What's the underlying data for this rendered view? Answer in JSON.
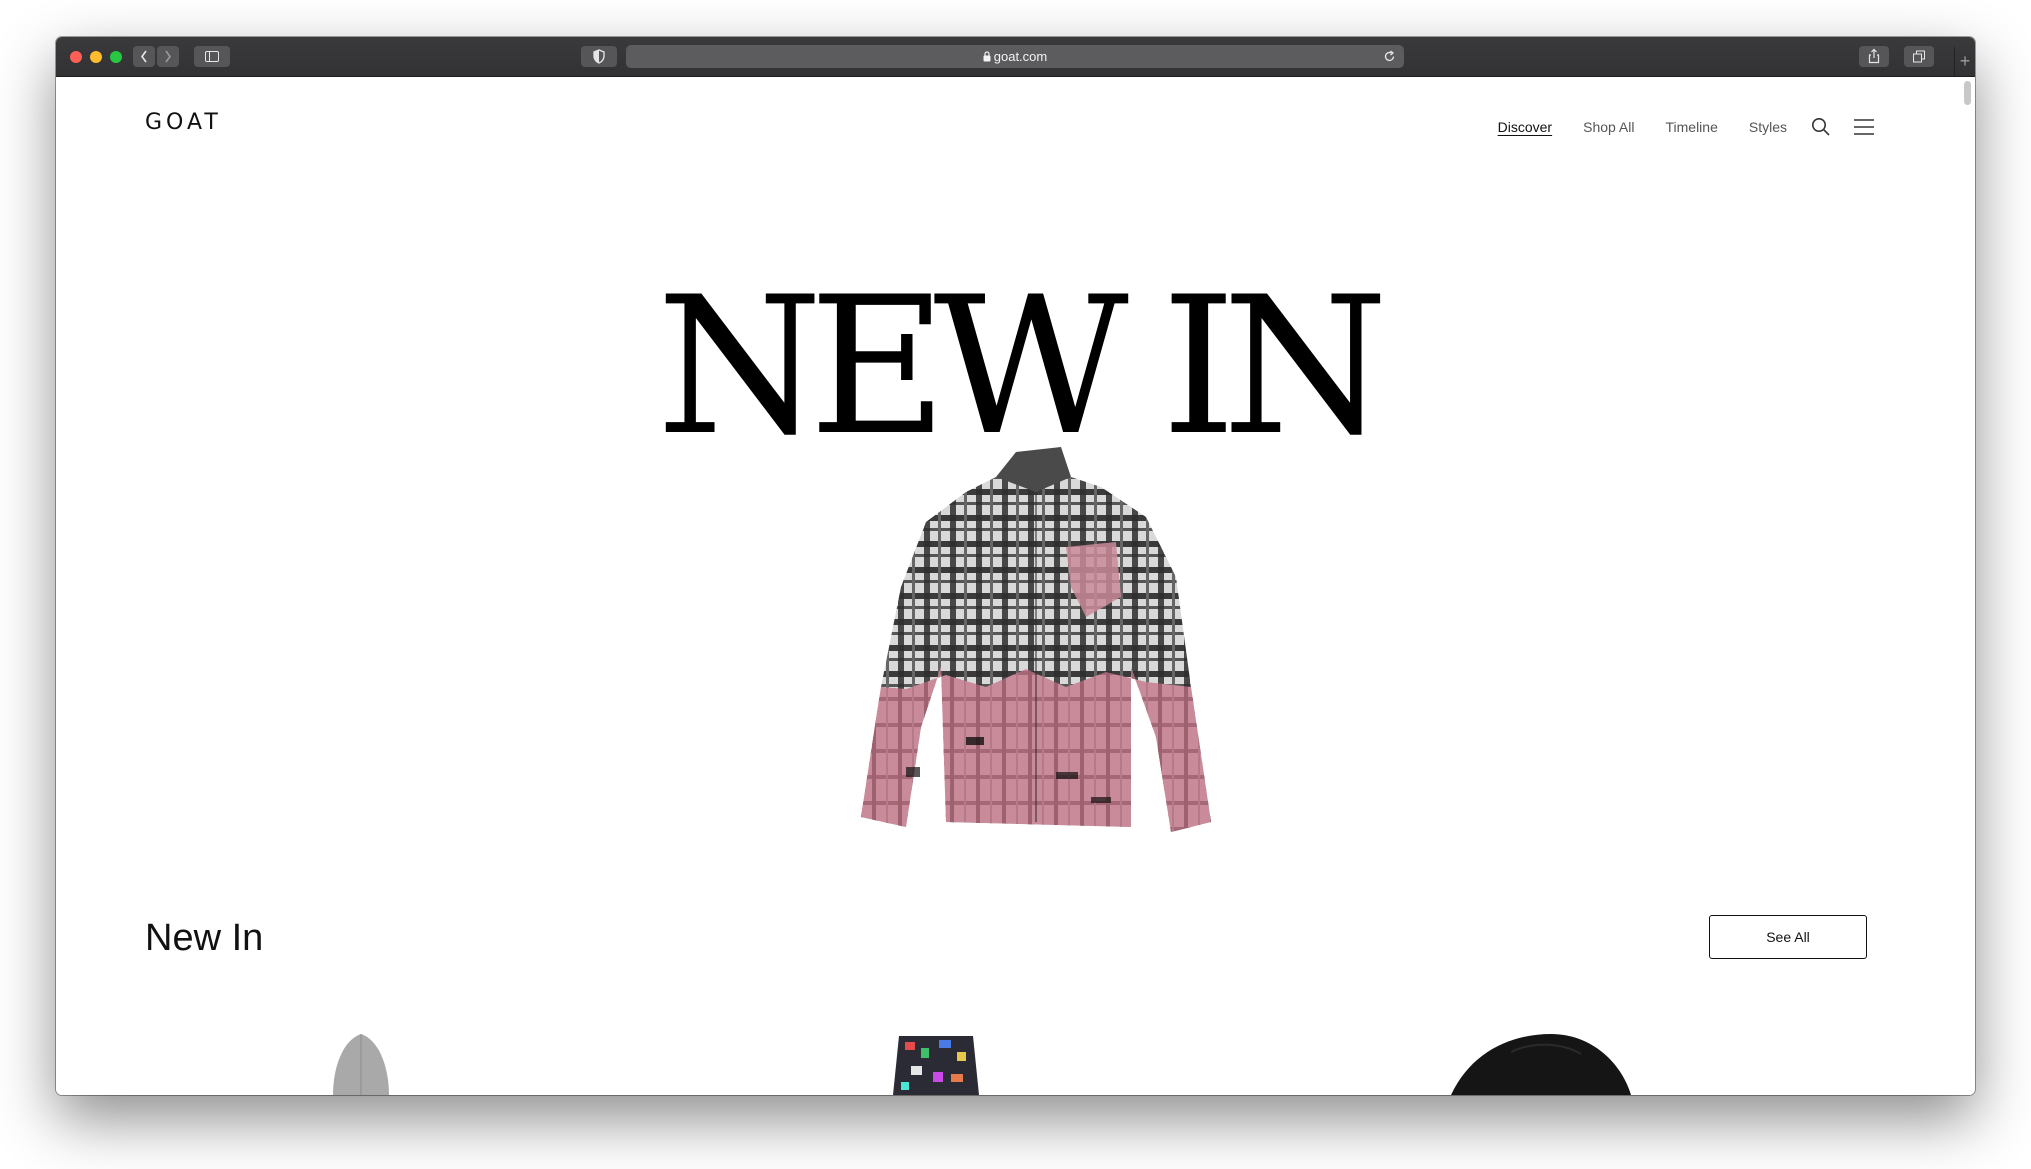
{
  "browser": {
    "url": "goat.com",
    "colors": {
      "close": "#ff5f57",
      "minimize": "#febc2e",
      "zoom": "#28c840"
    }
  },
  "header": {
    "logo": "GOAT",
    "nav": [
      {
        "label": "Discover",
        "active": true
      },
      {
        "label": "Shop All",
        "active": false
      },
      {
        "label": "Timeline",
        "active": false
      },
      {
        "label": "Styles",
        "active": false
      }
    ],
    "icons": [
      "search-icon",
      "menu-icon"
    ]
  },
  "hero": {
    "title": "NEW IN",
    "image": "plaid-shirt-pink-dyed"
  },
  "section": {
    "title": "New In",
    "see_all_label": "See All"
  },
  "products": [
    {
      "image": "grey-beanie"
    },
    {
      "image": "patterned-shorts"
    },
    {
      "image": "black-cap"
    }
  ]
}
